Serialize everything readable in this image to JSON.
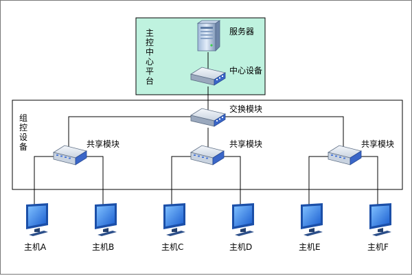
{
  "colors": {
    "background": "#ffffff",
    "control_platform_fill": "#bff2df",
    "group_device_fill": "#ffffff",
    "line": "#000000",
    "monitor_screen": "#2f7de0",
    "monitor_frame": "#1b4fa8"
  },
  "control_platform": {
    "label_chars": [
      "主",
      "控",
      "中",
      "心",
      "平",
      "台"
    ],
    "server": {
      "label": "服务器",
      "icon": "server-icon"
    },
    "core_device": {
      "label": "中心设备",
      "icon": "switch-icon"
    }
  },
  "group_device": {
    "label_chars": [
      "组",
      "控",
      "设",
      "备"
    ],
    "exchange_module": {
      "label": "交换模块",
      "icon": "switch-icon"
    },
    "shared_modules": [
      {
        "label": "共享模块",
        "icon": "switch-icon"
      },
      {
        "label": "共享模块",
        "icon": "switch-icon"
      },
      {
        "label": "共享模块",
        "icon": "switch-icon"
      }
    ]
  },
  "hosts": [
    {
      "label": "主机A",
      "icon": "monitor-icon"
    },
    {
      "label": "主机B",
      "icon": "monitor-icon"
    },
    {
      "label": "主机C",
      "icon": "monitor-icon"
    },
    {
      "label": "主机D",
      "icon": "monitor-icon"
    },
    {
      "label": "主机E",
      "icon": "monitor-icon"
    },
    {
      "label": "主机F",
      "icon": "monitor-icon"
    }
  ]
}
